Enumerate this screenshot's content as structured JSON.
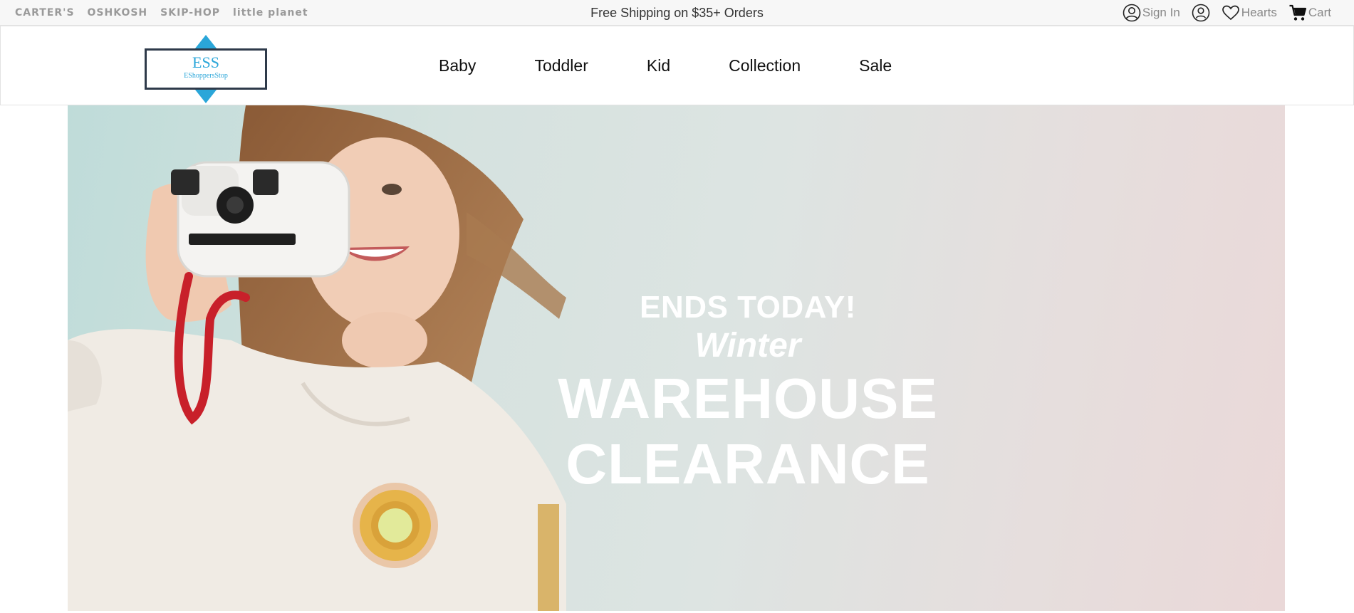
{
  "topbar": {
    "brand_links": [
      "CARTER'S",
      "OSHKOSH",
      "SKIP-HOP",
      "little planet"
    ],
    "promo": "Free Shipping on $35+ Orders",
    "sign_in": "Sign In",
    "hearts": "Hearts",
    "cart": "Cart",
    "icons": [
      "user-circle-icon",
      "account-icon",
      "heart-icon",
      "cart-icon"
    ]
  },
  "header": {
    "logo": {
      "main": "ESS",
      "sub": "EShoppersStop"
    },
    "nav": [
      "Baby",
      "Toddler",
      "Kid",
      "Collection",
      "Sale"
    ]
  },
  "hero": {
    "line1": "ENDS TODAY!",
    "line2": "Winter",
    "line3": "WAREHOUSE",
    "line4": "CLEARANCE"
  },
  "colors": {
    "accent": "#2aa6d9",
    "logo_border": "#2e3a4a",
    "topbar_bg": "#f7f7f7",
    "hero_text": "#ffffff"
  }
}
